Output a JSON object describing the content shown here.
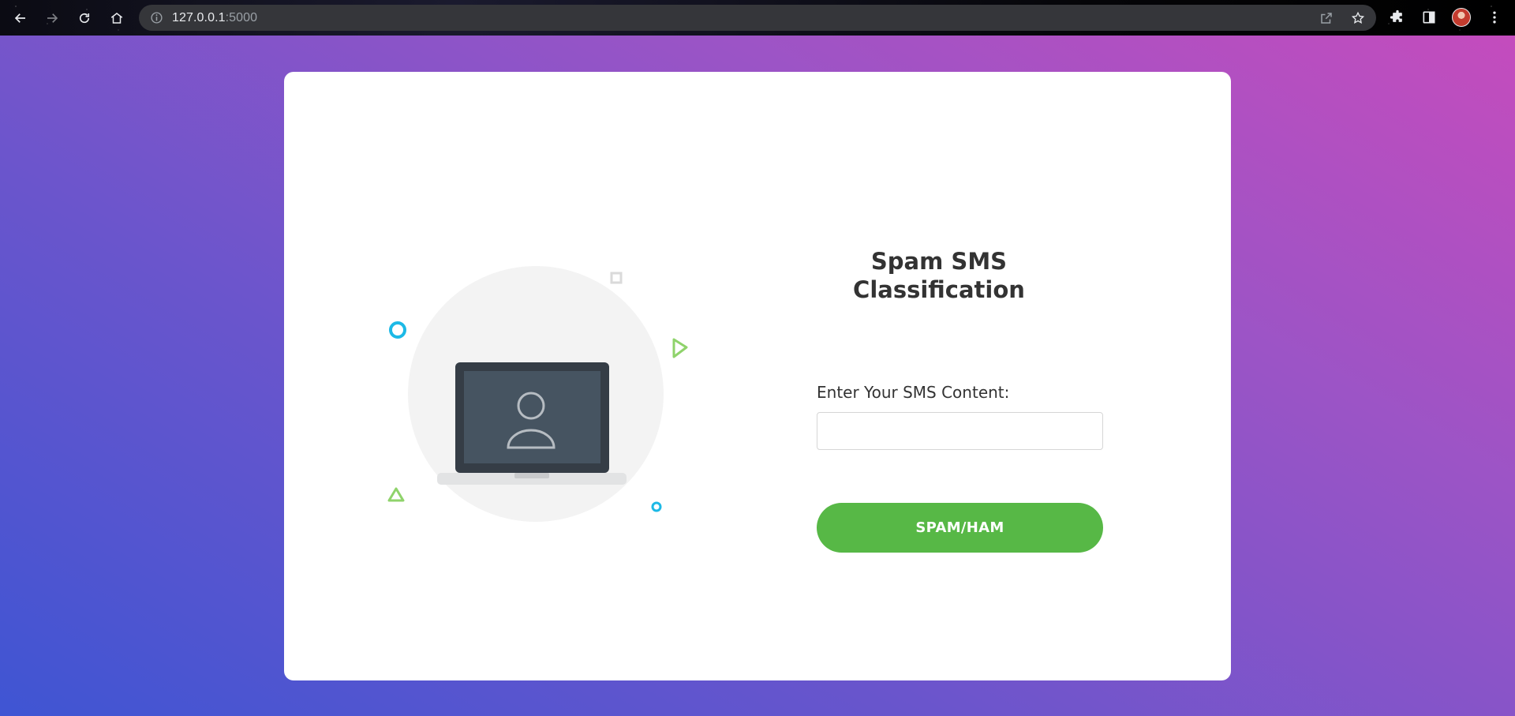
{
  "browser": {
    "url_host": "127.0.0.1",
    "url_port": ":5000"
  },
  "form": {
    "title_line1": "Spam SMS",
    "title_line2": "Classification",
    "field_label": "Enter Your SMS Content:",
    "input_value": "",
    "input_placeholder": "",
    "submit_label": "SPAM/HAM"
  },
  "icons": {
    "back": "back-arrow-icon",
    "forward": "forward-arrow-icon",
    "reload": "reload-icon",
    "home": "home-icon",
    "site_info": "info-icon",
    "share": "share-icon",
    "bookmark": "star-icon",
    "extensions": "puzzle-icon",
    "side_panel": "side-panel-icon",
    "menu": "kebab-menu-icon"
  },
  "colors": {
    "gradient_start": "#3f55d3",
    "gradient_end": "#c44cbd",
    "button": "#57b846",
    "title_text": "#333333"
  }
}
